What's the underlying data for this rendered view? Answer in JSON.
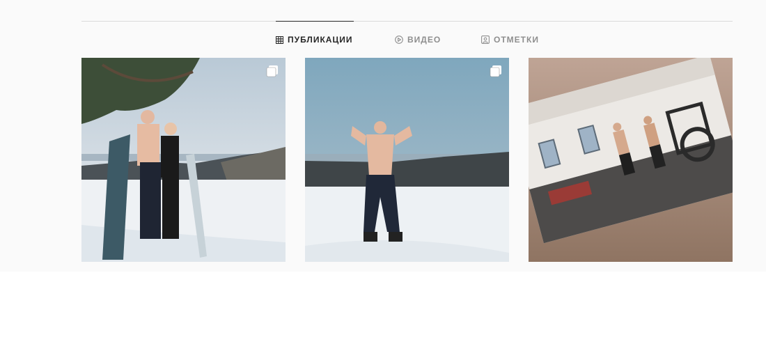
{
  "tabs": [
    {
      "label": "ПУБЛИКАЦИИ",
      "icon": "grid-icon",
      "active": true
    },
    {
      "label": "ВИДЕО",
      "icon": "play-circle-icon",
      "active": false
    },
    {
      "label": "ОТМЕТКИ",
      "icon": "tagged-portrait-icon",
      "active": false
    }
  ],
  "posts": [
    {
      "type": "carousel",
      "icon": "carousel-icon"
    },
    {
      "type": "carousel",
      "icon": "carousel-icon"
    },
    {
      "type": "image"
    }
  ],
  "colors": {
    "active_tab": "#262626",
    "inactive_tab": "#8e8e8e",
    "divider": "#dbdbdb",
    "background": "#fafafa"
  }
}
